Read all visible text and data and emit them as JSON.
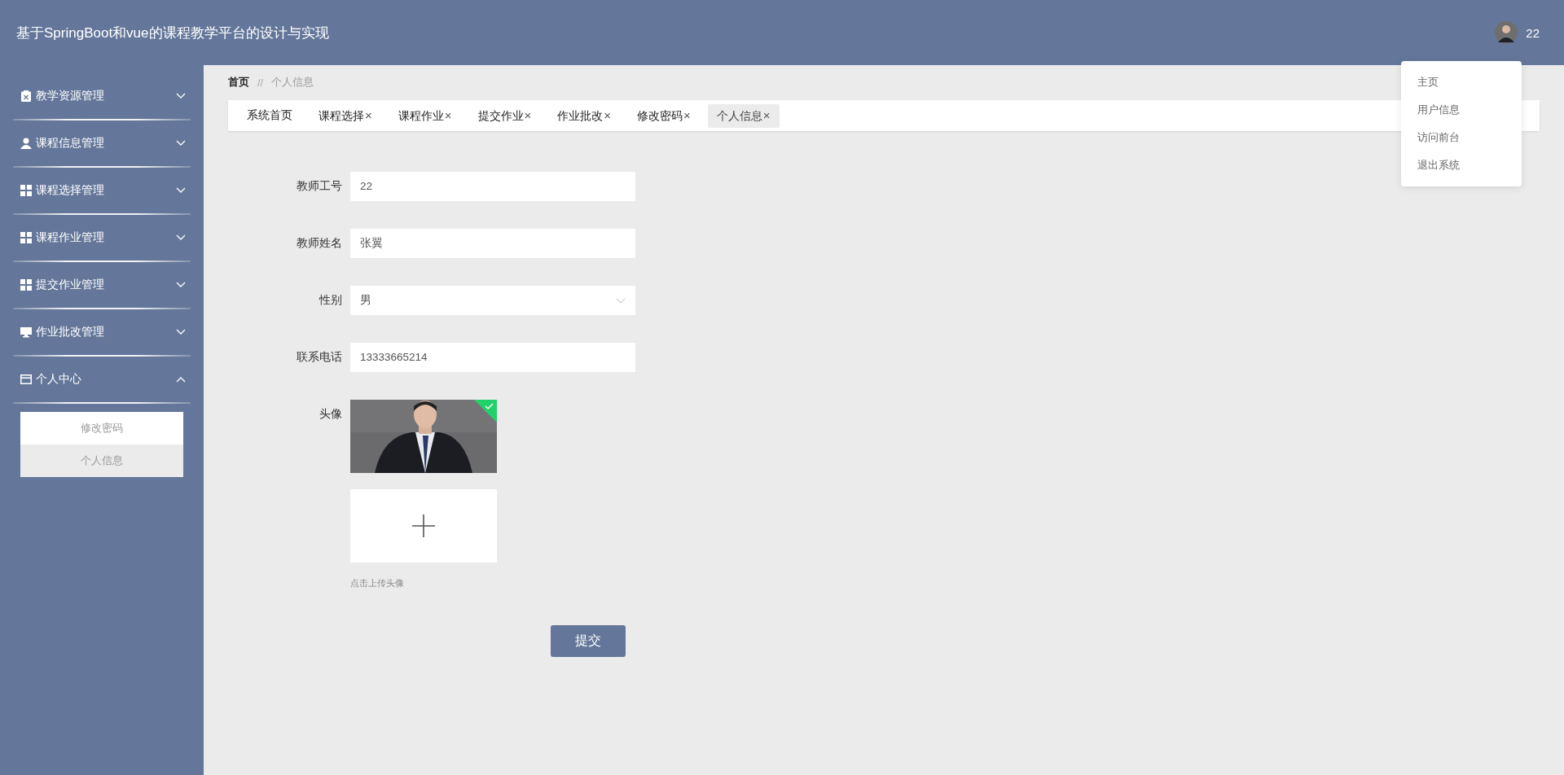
{
  "header": {
    "title": "基于SpringBoot和vue的课程教学平台的设计与实现",
    "username": "22"
  },
  "user_menu": {
    "items": [
      "主页",
      "用户信息",
      "访问前台",
      "退出系统"
    ]
  },
  "sidebar": {
    "items": [
      {
        "label": "教学资源管理",
        "expanded": false
      },
      {
        "label": "课程信息管理",
        "expanded": false
      },
      {
        "label": "课程选择管理",
        "expanded": false
      },
      {
        "label": "课程作业管理",
        "expanded": false
      },
      {
        "label": "提交作业管理",
        "expanded": false
      },
      {
        "label": "作业批改管理",
        "expanded": false
      },
      {
        "label": "个人中心",
        "expanded": true,
        "children": [
          {
            "label": "修改密码",
            "selected": false
          },
          {
            "label": "个人信息",
            "selected": true
          }
        ]
      }
    ]
  },
  "breadcrumb": {
    "home": "首页",
    "separator": "//",
    "current": "个人信息"
  },
  "tabs": [
    {
      "label": "系统首页",
      "selected": false
    },
    {
      "label": "课程选择",
      "close": "×",
      "selected": false
    },
    {
      "label": "课程作业",
      "close": "×",
      "selected": false
    },
    {
      "label": "提交作业",
      "close": "×",
      "selected": false
    },
    {
      "label": "作业批改",
      "close": "×",
      "selected": false
    },
    {
      "label": "修改密码",
      "close": "×",
      "selected": false
    },
    {
      "label": "个人信息",
      "close": "×",
      "selected": true
    }
  ],
  "form": {
    "fields": [
      {
        "kind": "text",
        "label": "教师工号",
        "value": "22"
      },
      {
        "kind": "text",
        "label": "教师姓名",
        "value": "张翼"
      },
      {
        "kind": "select",
        "label": "性别",
        "value": "男"
      },
      {
        "kind": "text",
        "label": "联系电话",
        "value": "13333665214"
      },
      {
        "label": "头像",
        "hint": "点击上传头像"
      }
    ],
    "submit": "提交"
  }
}
